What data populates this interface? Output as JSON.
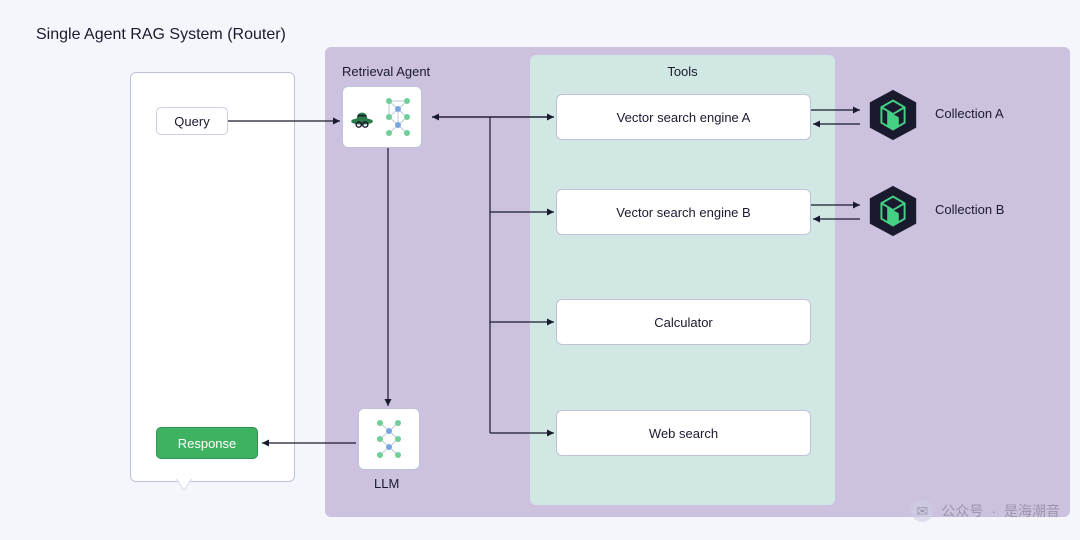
{
  "title": "Single Agent RAG System (Router)",
  "chat": {
    "query_label": "Query",
    "response_label": "Response"
  },
  "agent": {
    "label": "Retrieval Agent"
  },
  "llm": {
    "label": "LLM"
  },
  "tools": {
    "label": "Tools",
    "items": [
      "Vector search engine A",
      "Vector search engine B",
      "Calculator",
      "Web search"
    ]
  },
  "collections": {
    "a": "Collection A",
    "b": "Collection B"
  },
  "watermark": {
    "prefix": "公众号",
    "sep": "·",
    "name": "是海潮音"
  },
  "colors": {
    "bg": "#f5f6fb",
    "purple": "#cdc1e0",
    "teal": "#d0e7e3",
    "green": "#3fb262",
    "dark": "#1a1a2e",
    "accent": "#45d184"
  }
}
